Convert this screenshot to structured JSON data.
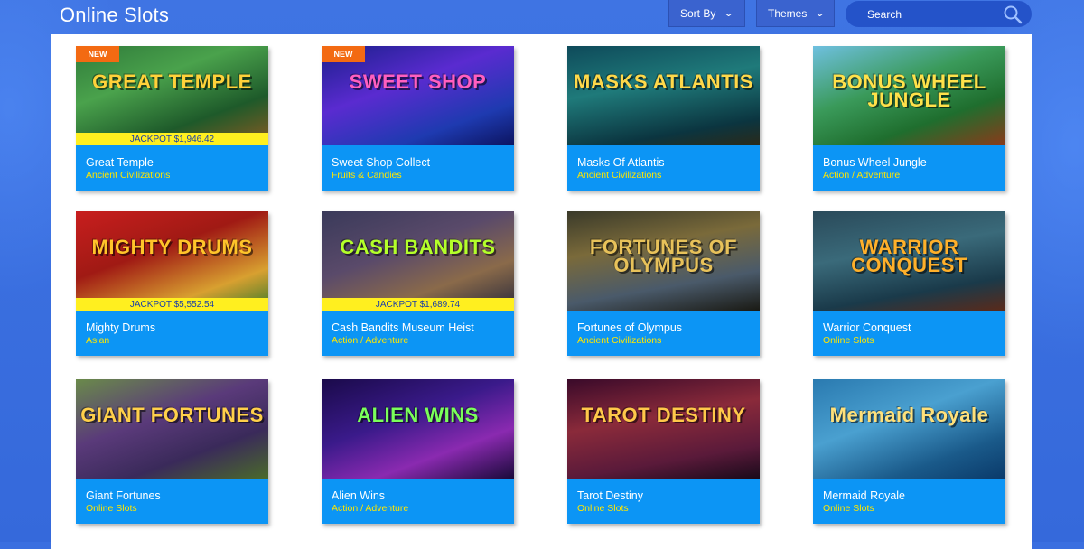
{
  "header": {
    "title": "Online Slots",
    "sort_label": "Sort By",
    "themes_label": "Themes",
    "search_placeholder": "Search"
  },
  "icons": {
    "chevron": "chevron-down-icon",
    "search": "search-icon"
  },
  "colors": {
    "background": "#3a6fe0",
    "card_footer": "#0c95f5",
    "category_text": "#ffe600",
    "jackpot_bar": "#ffef1f",
    "new_badge": "#f36a12"
  },
  "games": [
    {
      "name": "Great Temple",
      "category": "Ancient Civilizations",
      "badge": "NEW",
      "jackpot": "JACKPOT $1,946.42",
      "logo": "GREAT TEMPLE"
    },
    {
      "name": "Sweet Shop Collect",
      "category": "Fruits & Candies",
      "badge": "NEW",
      "jackpot": "",
      "logo": "SWEET SHOP"
    },
    {
      "name": "Masks Of Atlantis",
      "category": "Ancient Civilizations",
      "badge": "",
      "jackpot": "",
      "logo": "MASKS ATLANTIS"
    },
    {
      "name": "Bonus Wheel Jungle",
      "category": "Action / Adventure",
      "badge": "",
      "jackpot": "",
      "logo": "BONUS WHEEL JUNGLE"
    },
    {
      "name": "Mighty Drums",
      "category": "Asian",
      "badge": "",
      "jackpot": "JACKPOT $5,552.54",
      "logo": "MIGHTY DRUMS"
    },
    {
      "name": "Cash Bandits Museum Heist",
      "category": "Action / Adventure",
      "badge": "",
      "jackpot": "JACKPOT $1,689.74",
      "logo": "CASH BANDITS"
    },
    {
      "name": "Fortunes of Olympus",
      "category": "Ancient Civilizations",
      "badge": "",
      "jackpot": "",
      "logo": "FORTUNES OF OLYMPUS"
    },
    {
      "name": "Warrior Conquest",
      "category": "Online Slots",
      "badge": "",
      "jackpot": "",
      "logo": "WARRIOR CONQUEST"
    },
    {
      "name": "Giant Fortunes",
      "category": "Online Slots",
      "badge": "",
      "jackpot": "",
      "logo": "GIANT FORTUNES"
    },
    {
      "name": "Alien Wins",
      "category": "Action / Adventure",
      "badge": "",
      "jackpot": "",
      "logo": "ALIEN WINS"
    },
    {
      "name": "Tarot Destiny",
      "category": "Online Slots",
      "badge": "",
      "jackpot": "",
      "logo": "TAROT DESTINY"
    },
    {
      "name": "Mermaid Royale",
      "category": "Online Slots",
      "badge": "",
      "jackpot": "",
      "logo": "Mermaid Royale"
    }
  ]
}
